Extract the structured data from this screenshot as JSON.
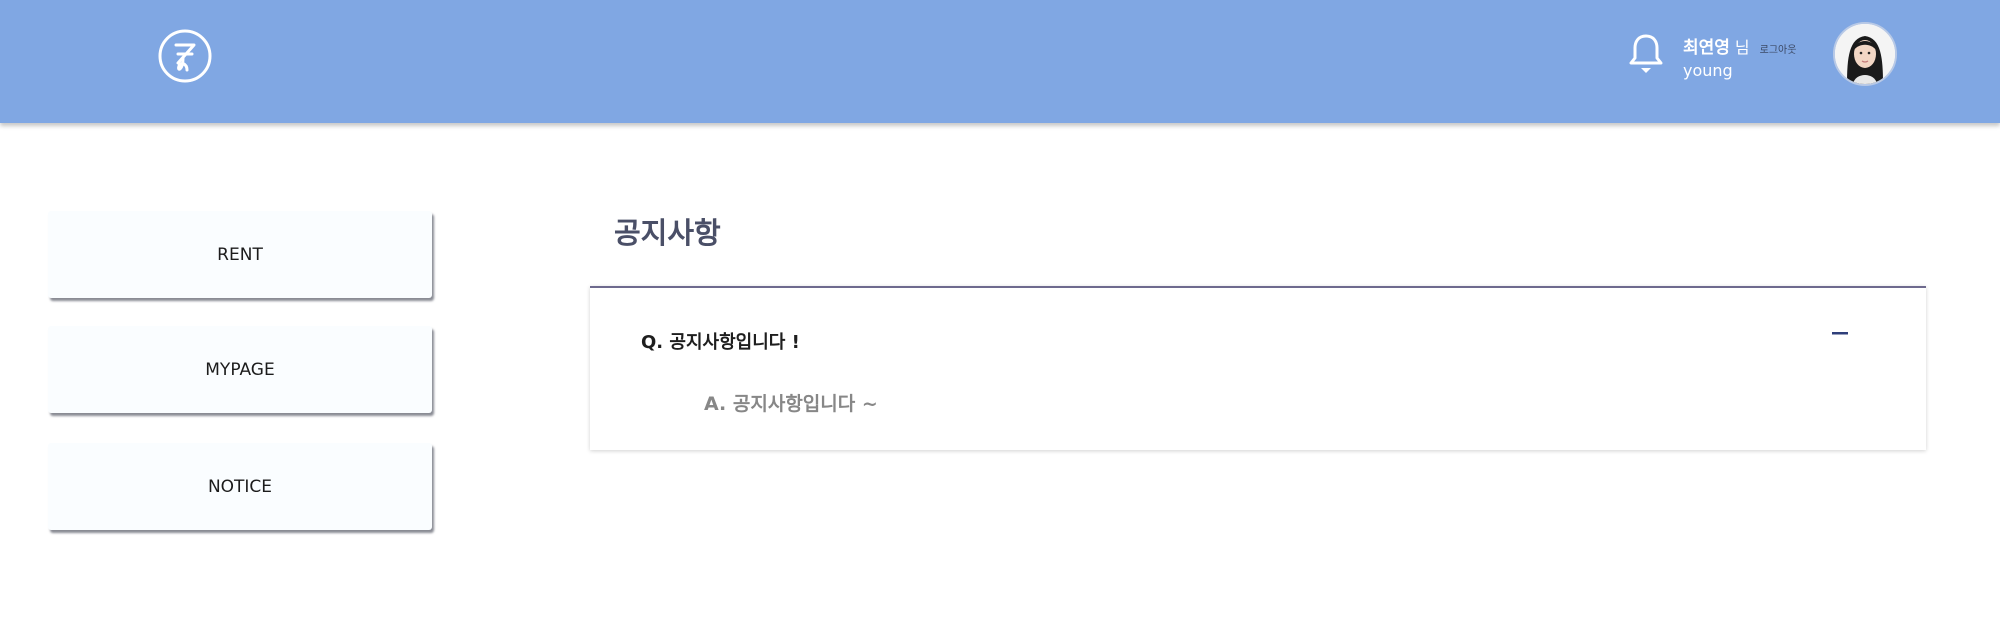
{
  "header": {
    "user": {
      "name": "최연영",
      "suffix": "님",
      "logout_label": "로그아웃",
      "id": "young"
    },
    "icons": {
      "logo": "logo-icon",
      "bell": "bell-icon",
      "avatar": "user-avatar"
    },
    "bg_color": "#80a7e3"
  },
  "sidebar": {
    "items": [
      {
        "label": "RENT"
      },
      {
        "label": "MYPAGE"
      },
      {
        "label": "NOTICE"
      }
    ]
  },
  "main": {
    "title": "공지사항",
    "notices": [
      {
        "question": "Q. 공지사항입니다 !",
        "answer": "A. 공지사항입니다 ~",
        "toggle_icon": "minus-icon"
      }
    ]
  }
}
